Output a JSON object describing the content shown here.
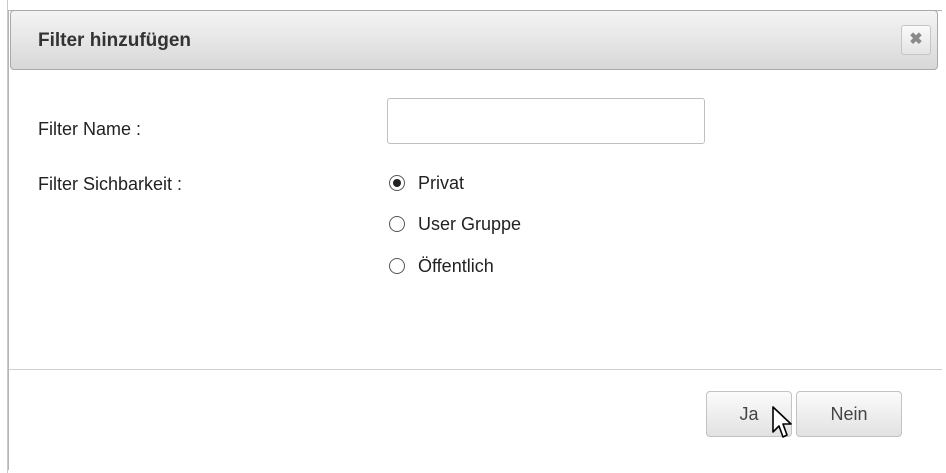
{
  "dialog": {
    "title": "Filter hinzufügen",
    "close_label": "✖"
  },
  "form": {
    "name_label": "Filter Name :",
    "name_value": "",
    "visibility_label": "Filter Sichbarkeit :",
    "visibility_options": [
      {
        "label": "Privat",
        "checked": true
      },
      {
        "label": "User Gruppe",
        "checked": false
      },
      {
        "label": "Öffentlich",
        "checked": false
      }
    ]
  },
  "buttons": {
    "yes_label": "Ja",
    "no_label": "Nein"
  }
}
